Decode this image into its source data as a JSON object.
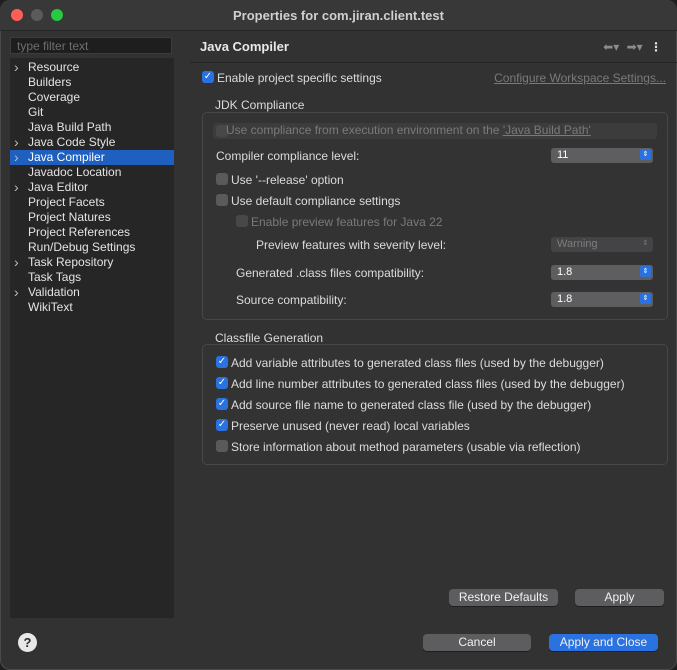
{
  "window": {
    "title": "Properties for com.jiran.client.test"
  },
  "sidebar": {
    "filter_placeholder": "type filter text",
    "items": [
      {
        "label": "Resource",
        "expandable": true,
        "selected": false
      },
      {
        "label": "Builders",
        "expandable": false,
        "selected": false
      },
      {
        "label": "Coverage",
        "expandable": false,
        "selected": false
      },
      {
        "label": "Git",
        "expandable": false,
        "selected": false
      },
      {
        "label": "Java Build Path",
        "expandable": false,
        "selected": false
      },
      {
        "label": "Java Code Style",
        "expandable": true,
        "selected": false
      },
      {
        "label": "Java Compiler",
        "expandable": true,
        "selected": true
      },
      {
        "label": "Javadoc Location",
        "expandable": false,
        "selected": false
      },
      {
        "label": "Java Editor",
        "expandable": true,
        "selected": false
      },
      {
        "label": "Project Facets",
        "expandable": false,
        "selected": false
      },
      {
        "label": "Project Natures",
        "expandable": false,
        "selected": false
      },
      {
        "label": "Project References",
        "expandable": false,
        "selected": false
      },
      {
        "label": "Run/Debug Settings",
        "expandable": false,
        "selected": false
      },
      {
        "label": "Task Repository",
        "expandable": true,
        "selected": false
      },
      {
        "label": "Task Tags",
        "expandable": false,
        "selected": false
      },
      {
        "label": "Validation",
        "expandable": true,
        "selected": false
      },
      {
        "label": "WikiText",
        "expandable": false,
        "selected": false
      }
    ]
  },
  "page": {
    "title": "Java Compiler",
    "enable_specific": {
      "label": "Enable project specific settings",
      "checked": true
    },
    "configure_link": "Configure Workspace Settings...",
    "jdk": {
      "group_label": "JDK Compliance",
      "use_ee": {
        "label": "Use compliance from execution environment on the ",
        "link": "'Java Build Path'",
        "checked": false
      },
      "compliance_level": {
        "label": "Compiler compliance level:",
        "value": "11"
      },
      "use_release": {
        "label": "Use '--release' option",
        "checked": false
      },
      "use_default": {
        "label": "Use default compliance settings",
        "checked": false
      },
      "enable_preview": {
        "label": "Enable preview features for Java 22",
        "checked": false
      },
      "preview_severity": {
        "label": "Preview features with severity level:",
        "value": "Warning"
      },
      "class_compat": {
        "label": "Generated .class files compatibility:",
        "value": "1.8"
      },
      "source_compat": {
        "label": "Source compatibility:",
        "value": "1.8"
      }
    },
    "classfile": {
      "group_label": "Classfile Generation",
      "options": [
        {
          "label": "Add variable attributes to generated class files (used by the debugger)",
          "checked": true
        },
        {
          "label": "Add line number attributes to generated class files (used by the debugger)",
          "checked": true
        },
        {
          "label": "Add source file name to generated class file (used by the debugger)",
          "checked": true
        },
        {
          "label": "Preserve unused (never read) local variables",
          "checked": true
        },
        {
          "label": "Store information about method parameters (usable via reflection)",
          "checked": false
        }
      ]
    },
    "restore_defaults": "Restore Defaults",
    "apply": "Apply"
  },
  "footer": {
    "help_glyph": "?",
    "cancel": "Cancel",
    "apply_close": "Apply and Close"
  },
  "colors": {
    "accent": "#2a72e0",
    "selection": "#1f5fbf"
  }
}
